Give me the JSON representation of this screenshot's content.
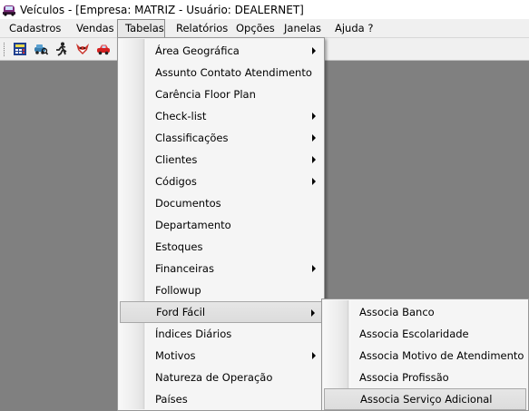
{
  "window": {
    "title": "Veículos - [Empresa: MATRIZ  - Usuário: DEALERNET]"
  },
  "menubar": [
    {
      "label": "Cadastros"
    },
    {
      "label": "Vendas"
    },
    {
      "label": "Tabelas"
    },
    {
      "label": "Relatórios"
    },
    {
      "label": "Opções"
    },
    {
      "label": "Janelas"
    },
    {
      "label": "Ajuda ?"
    }
  ],
  "toolbar": {
    "icons": [
      "calculator-icon",
      "car-search-icon",
      "runner-icon",
      "fox-mascot-icon",
      "red-car-icon"
    ]
  },
  "tabelas_menu": {
    "items": [
      {
        "label": "Área Geográfica",
        "submenu": true
      },
      {
        "label": "Assunto Contato Atendimento",
        "submenu": false
      },
      {
        "label": "Carência Floor Plan",
        "submenu": false
      },
      {
        "label": "Check-list",
        "submenu": true
      },
      {
        "label": "Classificações",
        "submenu": true
      },
      {
        "label": "Clientes",
        "submenu": true
      },
      {
        "label": "Códigos",
        "submenu": true
      },
      {
        "label": "Documentos",
        "submenu": false
      },
      {
        "label": "Departamento",
        "submenu": false
      },
      {
        "label": "Estoques",
        "submenu": false
      },
      {
        "label": "Financeiras",
        "submenu": true
      },
      {
        "label": "Followup",
        "submenu": false
      },
      {
        "label": "Ford Fácil",
        "submenu": true
      },
      {
        "label": "Índices Diários",
        "submenu": false
      },
      {
        "label": "Motivos",
        "submenu": true
      },
      {
        "label": "Natureza de Operação",
        "submenu": false
      },
      {
        "label": "Países",
        "submenu": false
      }
    ]
  },
  "ford_facil_menu": {
    "items": [
      {
        "label": "Associa Banco"
      },
      {
        "label": "Associa Escolaridade"
      },
      {
        "label": "Associa Motivo de Atendimento"
      },
      {
        "label": "Associa Profissão"
      },
      {
        "label": "Associa Serviço Adicional"
      }
    ]
  }
}
